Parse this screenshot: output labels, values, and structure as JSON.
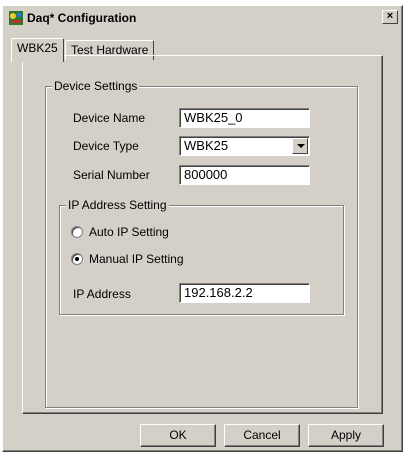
{
  "window": {
    "title": "Daq* Configuration",
    "close_symbol": "×",
    "icon": "daq-app-icon"
  },
  "tabs": [
    {
      "label": "WBK25",
      "active": true
    },
    {
      "label": "Test Hardware",
      "active": false
    }
  ],
  "device_settings": {
    "legend": "Device Settings",
    "device_name_label": "Device Name",
    "device_name_value": "WBK25_0",
    "device_type_label": "Device Type",
    "device_type_value": "WBK25",
    "serial_number_label": "Serial Number",
    "serial_number_value": "800000"
  },
  "ip_settings": {
    "legend": "IP Address Setting",
    "auto_ip_label": "Auto IP Setting",
    "auto_ip_selected": false,
    "manual_ip_label": "Manual IP Setting",
    "manual_ip_selected": true,
    "ip_address_label": "IP Address",
    "ip_address_value": "192.168.2.2"
  },
  "buttons": {
    "ok": "OK",
    "cancel": "Cancel",
    "apply": "Apply"
  },
  "colors": {
    "face": "#d4d0c8",
    "field_bg": "#ffffff"
  }
}
